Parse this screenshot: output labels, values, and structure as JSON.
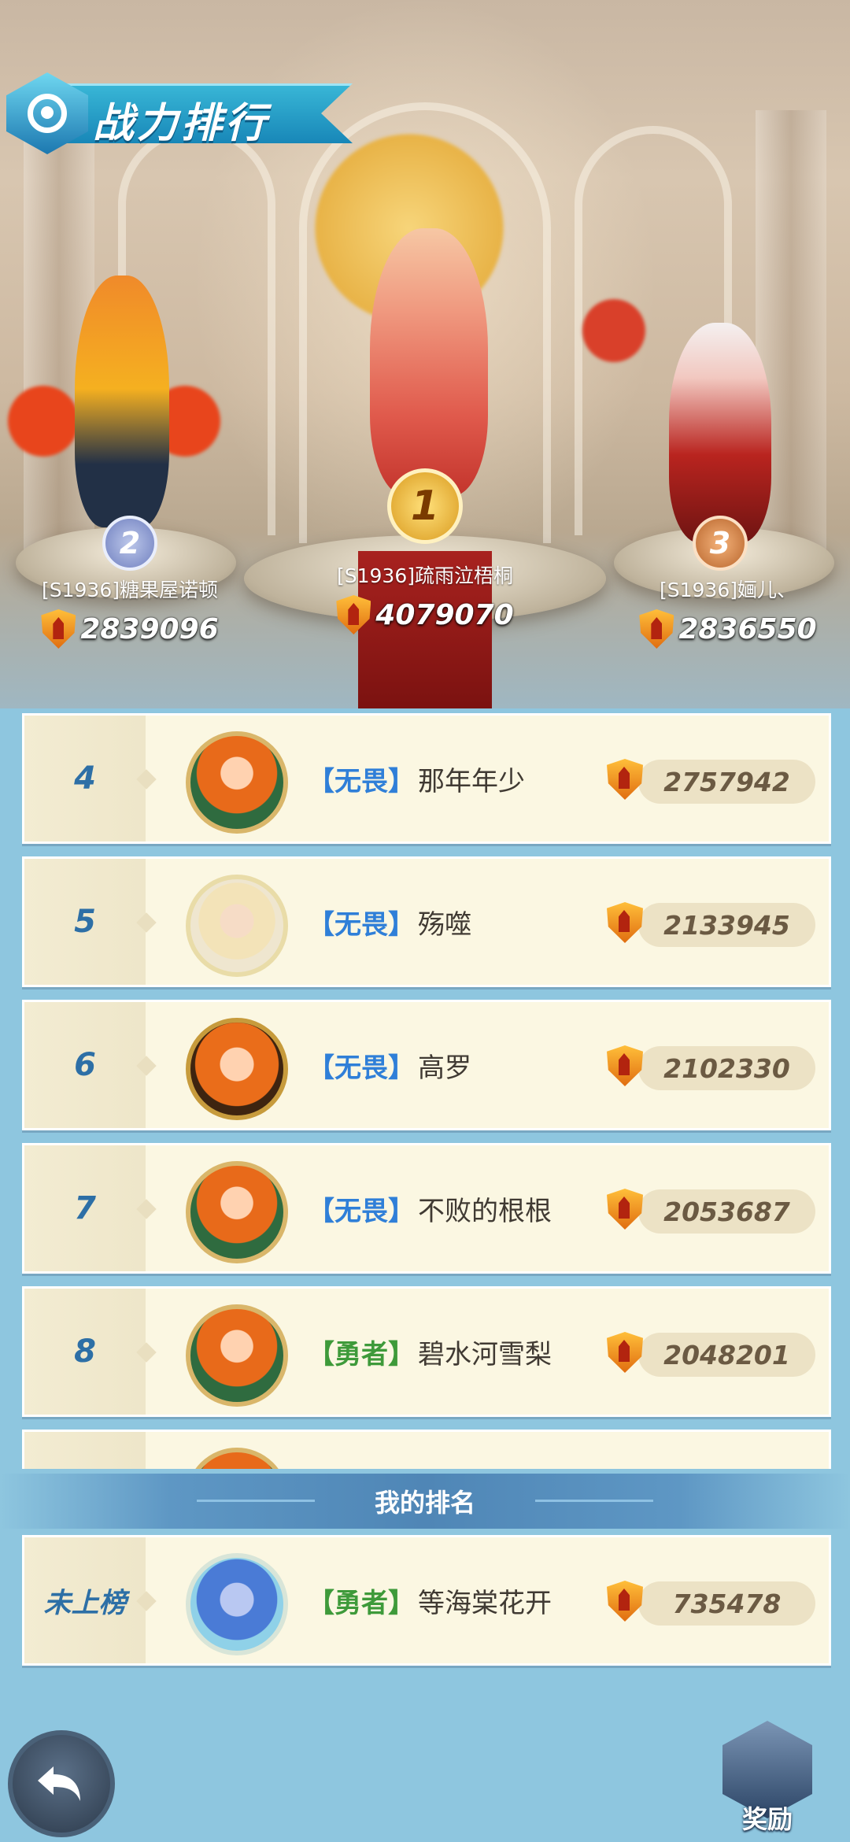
{
  "title": "战力排行",
  "top3": [
    {
      "rank": "2",
      "name": "[S1936]糖果屋诺顿",
      "power": "2839096"
    },
    {
      "rank": "1",
      "name": "[S1936]疏雨泣梧桐",
      "power": "4079070"
    },
    {
      "rank": "3",
      "name": "[S1936]婳儿、",
      "power": "2836550"
    }
  ],
  "rows": [
    {
      "rank": "4",
      "tag": "【无畏】",
      "name": "那年年少",
      "power": "2757942"
    },
    {
      "rank": "5",
      "tag": "【无畏】",
      "name": "殇噬",
      "power": "2133945"
    },
    {
      "rank": "6",
      "tag": "【无畏】",
      "name": "高罗",
      "power": "2102330"
    },
    {
      "rank": "7",
      "tag": "【无畏】",
      "name": "不败的根根",
      "power": "2053687"
    },
    {
      "rank": "8",
      "tag": "【勇者】",
      "name": "碧水河雪梨",
      "power": "2048201"
    }
  ],
  "my_rank": {
    "header": "我的排名",
    "rank": "未上榜",
    "tag": "【勇者】",
    "name": "等海棠花开",
    "power": "735478"
  },
  "buttons": {
    "reward_label": "奖励"
  },
  "colors": {
    "tag_wuwei": "#2f7fd8",
    "tag_yongzhe": "#3e9a3a",
    "rank_number": "#2d6fa6",
    "row_bg": "#fbf7e2"
  }
}
